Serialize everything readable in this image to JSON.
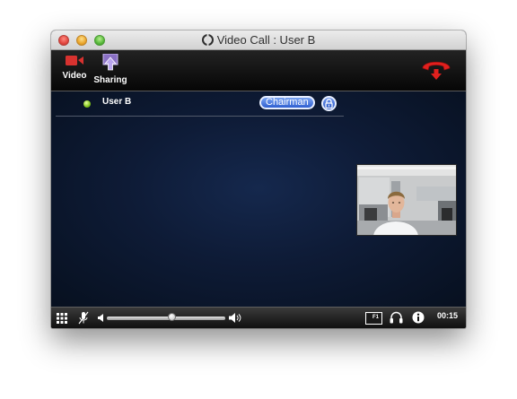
{
  "window": {
    "title": "Video Call : User B"
  },
  "toolbar": {
    "video_label": "Video",
    "sharing_label": "Sharing"
  },
  "participant": {
    "name": "User B",
    "role_badge": "Chairman",
    "status": "online"
  },
  "controls": {
    "volume_level": 0.55,
    "timer": "00:15",
    "fullscreen_label": "F1"
  },
  "colors": {
    "video_icon": "#d8322f",
    "hangup_red": "#e0201e",
    "badge_blue": "#3f6fd8",
    "status_green": "#7fc21b"
  }
}
